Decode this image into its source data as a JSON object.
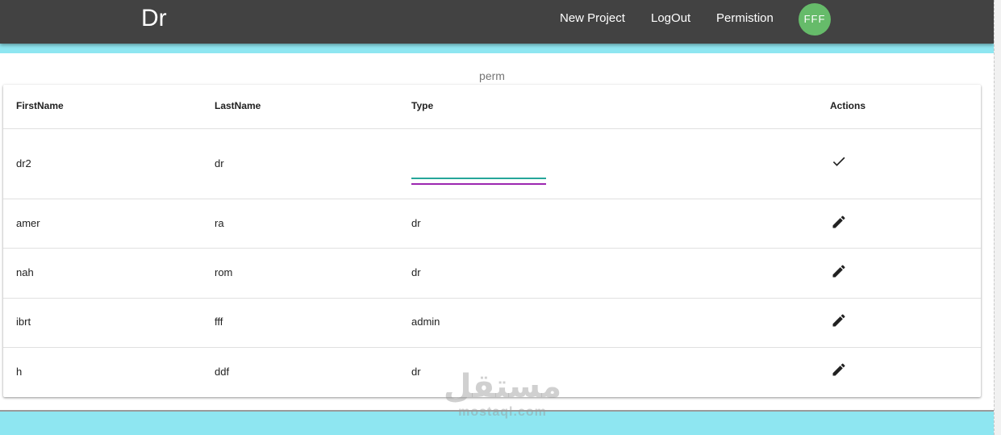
{
  "navbar": {
    "brand": "Dr",
    "links": [
      "New Project",
      "LogOut",
      "Permistion"
    ],
    "avatar": "FFF",
    "colors": {
      "background": "#424242",
      "avatar": "#66bb6a",
      "band": "#8ee6f1"
    }
  },
  "page": {
    "title": "perm"
  },
  "table": {
    "headers": [
      "FirstName",
      "LastName",
      "Type",
      "Actions"
    ],
    "editing_row": {
      "first": "dr2",
      "last": "dr",
      "type": "",
      "action_icon": "check-icon"
    },
    "rows": [
      {
        "first": "amer",
        "last": "ra",
        "type": "dr",
        "action_icon": "edit-icon"
      },
      {
        "first": "nah",
        "last": "rom",
        "type": "dr",
        "action_icon": "edit-icon"
      },
      {
        "first": "ibrt",
        "last": "fff",
        "type": "admin",
        "action_icon": "edit-icon"
      },
      {
        "first": "h",
        "last": "ddf",
        "type": "dr",
        "action_icon": "edit-icon"
      }
    ]
  },
  "watermark": {
    "arabic": "مستقل",
    "latin": "mostaql.com"
  }
}
